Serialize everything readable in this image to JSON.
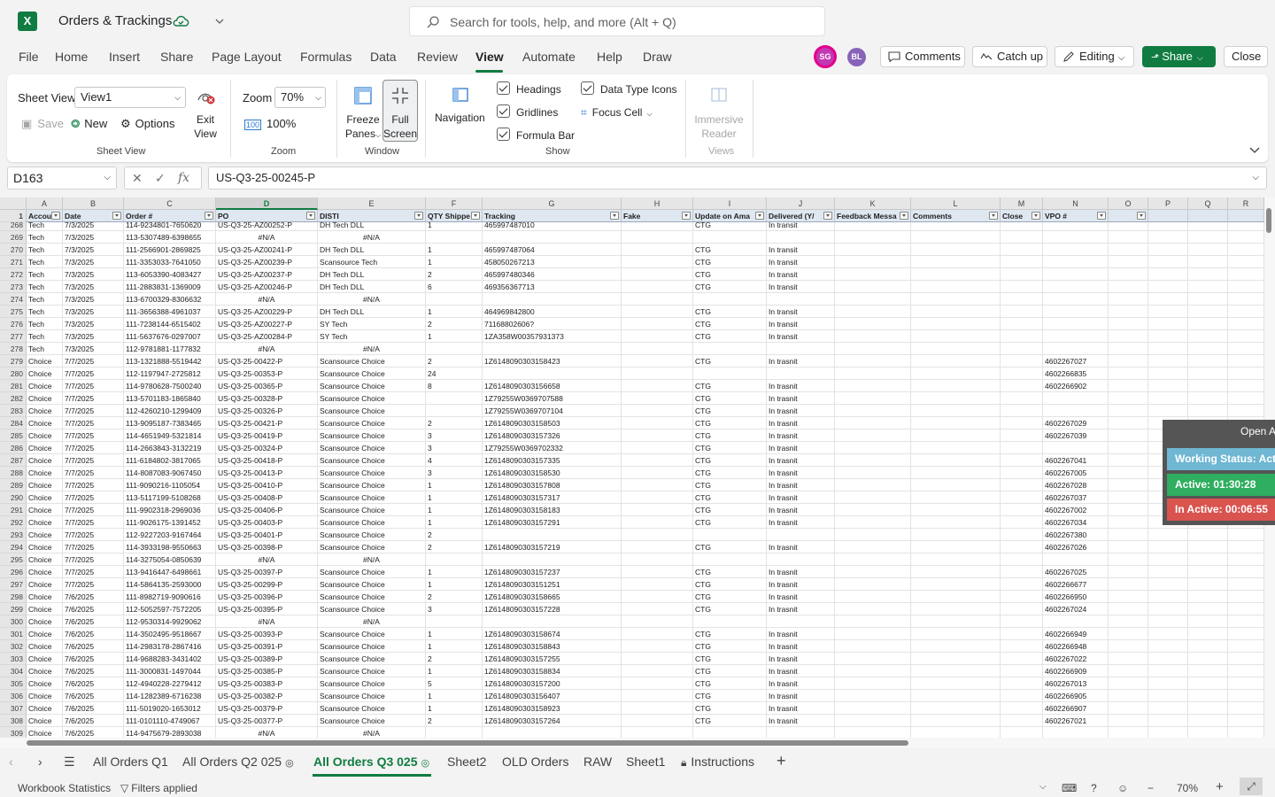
{
  "app": {
    "title": "Orders & Trackings",
    "search_placeholder": "Search for tools, help, and more (Alt + Q)",
    "logo_letter": "X"
  },
  "menu": [
    "File",
    "Home",
    "Insert",
    "Share",
    "Page Layout",
    "Formulas",
    "Data",
    "Review",
    "View",
    "Automate",
    "Help",
    "Draw"
  ],
  "active_menu": "View",
  "avatars": [
    "SG",
    "BL"
  ],
  "top_buttons": {
    "comments": "Comments",
    "catchup": "Catch up",
    "editing": "Editing",
    "share": "Share",
    "close": "Close"
  },
  "ribbon": {
    "sheet_view_label": "Sheet View",
    "sheet_view_value": "View1",
    "exit_view": "Exit",
    "exit_view2": "View",
    "save": "Save",
    "new": "New",
    "options": "Options",
    "group_sheet_view": "Sheet View",
    "zoom_label": "Zoom",
    "zoom_value": "70%",
    "zoom_100": "100%",
    "group_zoom": "Zoom",
    "freeze": "Freeze",
    "freeze2": "Panes",
    "full": "Full",
    "full2": "Screen",
    "group_window": "Window",
    "navigation": "Navigation",
    "headings": "Headings",
    "gridlines": "Gridlines",
    "formula_bar": "Formula Bar",
    "data_type_icons": "Data Type Icons",
    "focus_cell": "Focus Cell",
    "group_show": "Show",
    "immersive": "Immersive",
    "reader": "Reader",
    "group_views": "Views"
  },
  "formula_bar": {
    "name_box": "D163",
    "formula": "US-Q3-25-00245-P",
    "fx": "fx"
  },
  "columns": [
    "A",
    "B",
    "C",
    "D",
    "E",
    "F",
    "G",
    "H",
    "I",
    "J",
    "K",
    "L",
    "M",
    "N",
    "O",
    "P",
    "Q",
    "R"
  ],
  "header_row_number": "1",
  "headers": [
    "Accou",
    "Date",
    "Order #",
    "PO",
    "DISTI",
    "QTY Shippe",
    "Tracking",
    "Fake",
    "Update on Ama",
    "Delivered (Y/",
    "Feedback Messa",
    "Comments",
    "Close",
    "VPO #",
    "",
    "",
    "",
    ""
  ],
  "rows": [
    [
      "268",
      "Tech",
      "7/3/2025",
      "114-9234801-7650620",
      "US-Q3-25-AZ00252-P",
      "DH Tech DLL",
      "1",
      "465997487010",
      "",
      "CTG",
      "In transit",
      "",
      "",
      "",
      ""
    ],
    [
      "269",
      "Tech",
      "7/3/2025",
      "113-5307489-6398655",
      "#N/A",
      "#N/A",
      "",
      "",
      "",
      "",
      "",
      "",
      "",
      "",
      ""
    ],
    [
      "270",
      "Tech",
      "7/3/2025",
      "111-2566901-2869825",
      "US-Q3-25-AZ00241-P",
      "DH Tech DLL",
      "1",
      "465997487064",
      "",
      "CTG",
      "In transit",
      "",
      "",
      "",
      ""
    ],
    [
      "271",
      "Tech",
      "7/3/2025",
      "111-3353033-7641050",
      "US-Q3-25-AZ00239-P",
      "Scansource Tech",
      "1",
      "458050267213",
      "",
      "CTG",
      "In transit",
      "",
      "",
      "",
      ""
    ],
    [
      "272",
      "Tech",
      "7/3/2025",
      "113-6053390-4083427",
      "US-Q3-25-AZ00237-P",
      "DH Tech DLL",
      "2",
      "465997480346",
      "",
      "CTG",
      "In transit",
      "",
      "",
      "",
      ""
    ],
    [
      "273",
      "Tech",
      "7/3/2025",
      "111-2883831-1369009",
      "US-Q3-25-AZ00246-P",
      "DH Tech DLL",
      "6",
      "469356367713",
      "",
      "CTG",
      "In transit",
      "",
      "",
      "",
      ""
    ],
    [
      "274",
      "Tech",
      "7/3/2025",
      "113-6700329-8306632",
      "#N/A",
      "#N/A",
      "",
      "",
      "",
      "",
      "",
      "",
      "",
      "",
      ""
    ],
    [
      "275",
      "Tech",
      "7/3/2025",
      "111-3656388-4961037",
      "US-Q3-25-AZ00229-P",
      "DH Tech DLL",
      "1",
      "464969842800",
      "",
      "CTG",
      "In transit",
      "",
      "",
      "",
      ""
    ],
    [
      "276",
      "Tech",
      "7/3/2025",
      "111-7238144-6515402",
      "US-Q3-25-AZ00227-P",
      "SY Tech",
      "2",
      "71168802606?",
      "",
      "CTG",
      "In transit",
      "",
      "",
      "",
      ""
    ],
    [
      "277",
      "Tech",
      "7/3/2025",
      "111-5637676-0297007",
      "US-Q3-25-AZ00284-P",
      "SY Tech",
      "1",
      "1ZA358W00357931373",
      "",
      "CTG",
      "In transit",
      "",
      "",
      "",
      ""
    ],
    [
      "278",
      "Tech",
      "7/3/2025",
      "112-9781881-1177832",
      "#N/A",
      "#N/A",
      "",
      "",
      "",
      "",
      "",
      "",
      "",
      "",
      ""
    ],
    [
      "279",
      "Choice",
      "7/7/2025",
      "113-1321888-5519442",
      "US-Q3-25-00422-P",
      "Scansource Choice",
      "2",
      "1Z6148090303158423",
      "",
      "CTG",
      "In trasnit",
      "",
      "",
      "",
      "4602267027"
    ],
    [
      "280",
      "Choice",
      "7/7/2025",
      "112-1197947-2725812",
      "US-Q3-25-00353-P",
      "Scansource Choice",
      "24",
      "",
      "",
      "",
      "",
      "",
      "",
      "",
      "4602266835"
    ],
    [
      "281",
      "Choice",
      "7/7/2025",
      "114-9780628-7500240",
      "US-Q3-25-00365-P",
      "Scansource Choice",
      "8",
      "1Z6148090303156658",
      "",
      "CTG",
      "In trasnit",
      "",
      "",
      "",
      "4602266902"
    ],
    [
      "282",
      "Choice",
      "7/7/2025",
      "113-5701183-1865840",
      "US-Q3-25-00328-P",
      "Scansource Choice",
      "",
      "1Z79255W0369707588",
      "",
      "CTG",
      "In trasnit",
      "",
      "",
      "",
      ""
    ],
    [
      "283",
      "Choice",
      "7/7/2025",
      "112-4260210-1299409",
      "US-Q3-25-00326-P",
      "Scansource Choice",
      "",
      "1Z79255W0369707104",
      "",
      "CTG",
      "In trasnit",
      "",
      "",
      "",
      ""
    ],
    [
      "284",
      "Choice",
      "7/7/2025",
      "113-9095187-7383465",
      "US-Q3-25-00421-P",
      "Scansource Choice",
      "2",
      "1Z6148090303158503",
      "",
      "CTG",
      "In trasnit",
      "",
      "",
      "",
      "4602267029"
    ],
    [
      "285",
      "Choice",
      "7/7/2025",
      "114-4651949-5321814",
      "US-Q3-25-00419-P",
      "Scansource Choice",
      "3",
      "1Z6148090303157326",
      "",
      "CTG",
      "In trasnit",
      "",
      "",
      "",
      "4602267039"
    ],
    [
      "286",
      "Choice",
      "7/7/2025",
      "114-2663843-3132219",
      "US-Q3-25-00324-P",
      "Scansource Choice",
      "3",
      "1Z79255W0369702332",
      "",
      "CTG",
      "In trasnit",
      "",
      "",
      "",
      ""
    ],
    [
      "287",
      "Choice",
      "7/7/2025",
      "111-6184802-3817065",
      "US-Q3-25-00418-P",
      "Scansource Choice",
      "4",
      "1Z6148090303157335",
      "",
      "CTG",
      "In trasnit",
      "",
      "",
      "",
      "4602267041"
    ],
    [
      "288",
      "Choice",
      "7/7/2025",
      "114-8087083-9067450",
      "US-Q3-25-00413-P",
      "Scansource Choice",
      "3",
      "1Z6148090303158530",
      "",
      "CTG",
      "In trasnit",
      "",
      "",
      "",
      "4602267005"
    ],
    [
      "289",
      "Choice",
      "7/7/2025",
      "111-9090216-1105054",
      "US-Q3-25-00410-P",
      "Scansource Choice",
      "1",
      "1Z6148090303157808",
      "",
      "CTG",
      "In trasnit",
      "",
      "",
      "",
      "4602267028"
    ],
    [
      "290",
      "Choice",
      "7/7/2025",
      "113-5117199-5108268",
      "US-Q3-25-00408-P",
      "Scansource Choice",
      "1",
      "1Z6148090303157317",
      "",
      "CTG",
      "In trasnit",
      "",
      "",
      "",
      "4602267037"
    ],
    [
      "291",
      "Choice",
      "7/7/2025",
      "111-9902318-2969036",
      "US-Q3-25-00406-P",
      "Scansource Choice",
      "1",
      "1Z6148090303158183",
      "",
      "CTG",
      "In trasnit",
      "",
      "",
      "",
      "4602267002"
    ],
    [
      "292",
      "Choice",
      "7/7/2025",
      "111-9026175-1391452",
      "US-Q3-25-00403-P",
      "Scansource Choice",
      "1",
      "1Z6148090303157291",
      "",
      "CTG",
      "In trasnit",
      "",
      "",
      "",
      "4602267034"
    ],
    [
      "293",
      "Choice",
      "7/7/2025",
      "112-9227203-9167464",
      "US-Q3-25-00401-P",
      "Scansource Choice",
      "2",
      "",
      "",
      "",
      "",
      "",
      "",
      "",
      "4602267380"
    ],
    [
      "294",
      "Choice",
      "7/7/2025",
      "114-3933198-9550663",
      "US-Q3-25-00398-P",
      "Scansource Choice",
      "2",
      "1Z6148090303157219",
      "",
      "CTG",
      "In trasnit",
      "",
      "",
      "",
      "4602267026"
    ],
    [
      "295",
      "Choice",
      "7/7/2025",
      "114-3275054-0850639",
      "#N/A",
      "#N/A",
      "",
      "",
      "",
      "",
      "",
      "",
      "",
      "",
      ""
    ],
    [
      "296",
      "Choice",
      "7/7/2025",
      "113-9416447-6498661",
      "US-Q3-25-00397-P",
      "Scansource Choice",
      "1",
      "1Z6148090303157237",
      "",
      "CTG",
      "In trasnit",
      "",
      "",
      "",
      "4602267025"
    ],
    [
      "297",
      "Choice",
      "7/7/2025",
      "114-5864135-2593000",
      "US-Q3-25-00299-P",
      "Scansource Choice",
      "1",
      "1Z6148090303151251",
      "",
      "CTG",
      "In trasnit",
      "",
      "",
      "",
      "4602266677"
    ],
    [
      "298",
      "Choice",
      "7/6/2025",
      "111-8982719-9090616",
      "US-Q3-25-00396-P",
      "Scansource Choice",
      "2",
      "1Z6148090303158665",
      "",
      "CTG",
      "In trasnit",
      "",
      "",
      "",
      "4602266950"
    ],
    [
      "299",
      "Choice",
      "7/6/2025",
      "112-5052597-7572205",
      "US-Q3-25-00395-P",
      "Scansource Choice",
      "3",
      "1Z6148090303157228",
      "",
      "CTG",
      "In trasnit",
      "",
      "",
      "",
      "4602267024"
    ],
    [
      "300",
      "Choice",
      "7/6/2025",
      "112-9530314-9929062",
      "#N/A",
      "#N/A",
      "",
      "",
      "",
      "",
      "",
      "",
      "",
      "",
      ""
    ],
    [
      "301",
      "Choice",
      "7/6/2025",
      "114-3502495-9518667",
      "US-Q3-25-00393-P",
      "Scansource Choice",
      "1",
      "1Z6148090303158674",
      "",
      "CTG",
      "In trasnit",
      "",
      "",
      "",
      "4602266949"
    ],
    [
      "302",
      "Choice",
      "7/6/2025",
      "114-2983178-2867416",
      "US-Q3-25-00391-P",
      "Scansource Choice",
      "1",
      "1Z6148090303158843",
      "",
      "CTG",
      "In trasnit",
      "",
      "",
      "",
      "4602266948"
    ],
    [
      "303",
      "Choice",
      "7/6/2025",
      "114-9688283-3431402",
      "US-Q3-25-00389-P",
      "Scansource Choice",
      "2",
      "1Z6148090303157255",
      "",
      "CTG",
      "In trasnit",
      "",
      "",
      "",
      "4602267022"
    ],
    [
      "304",
      "Choice",
      "7/6/2025",
      "111-3000831-1497044",
      "US-Q3-25-00385-P",
      "Scansource Choice",
      "1",
      "1Z6148090303158834",
      "",
      "CTG",
      "In trasnit",
      "",
      "",
      "",
      "4602266909"
    ],
    [
      "305",
      "Choice",
      "7/6/2025",
      "112-4940228-2279412",
      "US-Q3-25-00383-P",
      "Scansource Choice",
      "5",
      "1Z6148090303157200",
      "",
      "CTG",
      "In trasnit",
      "",
      "",
      "",
      "4602267013"
    ],
    [
      "306",
      "Choice",
      "7/6/2025",
      "114-1282389-6716238",
      "US-Q3-25-00382-P",
      "Scansource Choice",
      "1",
      "1Z6148090303156407",
      "",
      "CTG",
      "In trasnit",
      "",
      "",
      "",
      "4602266905"
    ],
    [
      "307",
      "Choice",
      "7/6/2025",
      "111-5019020-1653012",
      "US-Q3-25-00379-P",
      "Scansource Choice",
      "1",
      "1Z6148090303158923",
      "",
      "CTG",
      "In trasnit",
      "",
      "",
      "",
      "4602266907"
    ],
    [
      "308",
      "Choice",
      "7/6/2025",
      "111-0101110-4749067",
      "US-Q3-25-00377-P",
      "Scansource Choice",
      "2",
      "1Z6148090303157264",
      "",
      "CTG",
      "In trasnit",
      "",
      "",
      "",
      "4602267021"
    ],
    [
      "309",
      "Choice",
      "7/6/2025",
      "114-9475679-2893038",
      "#N/A",
      "#N/A",
      "",
      "",
      "",
      "",
      "",
      "",
      "",
      "",
      ""
    ]
  ],
  "sheet_tabs": [
    "All Orders Q1",
    "All Orders Q2 025",
    "All Orders Q3 025",
    "Sheet2",
    "OLD Orders",
    "RAW",
    "Sheet1",
    "Instructions"
  ],
  "active_sheet": "All Orders Q3 025",
  "status": {
    "workbook_statistics": "Workbook Statistics",
    "filters": "Filters applied",
    "zoom": "70%"
  },
  "popup": {
    "open_label": "Open A",
    "working_status": "Working Status: Acti",
    "active": "Active: 01:30:28",
    "inactive": "In Active: 00:06:55"
  },
  "colors": {
    "excel_green": "#107c41",
    "header_fill": "#dfe7f1",
    "working": "#6fb7d3",
    "active": "#2eae5e",
    "inactive": "#d9534f"
  }
}
